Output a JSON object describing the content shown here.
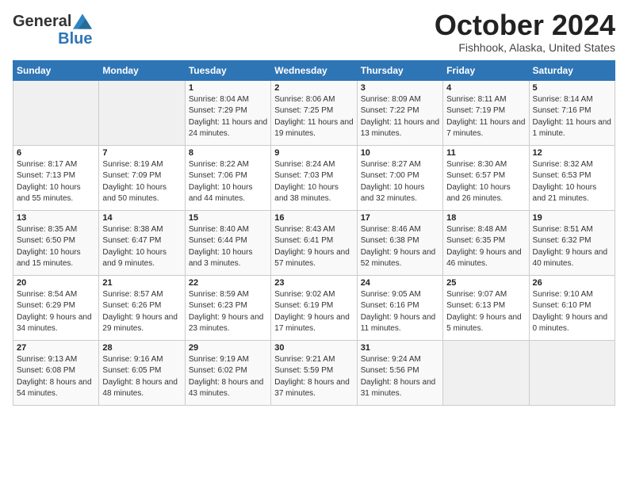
{
  "logo": {
    "general": "General",
    "blue": "Blue"
  },
  "title": {
    "month_year": "October 2024",
    "location": "Fishhook, Alaska, United States"
  },
  "weekdays": [
    "Sunday",
    "Monday",
    "Tuesday",
    "Wednesday",
    "Thursday",
    "Friday",
    "Saturday"
  ],
  "weeks": [
    [
      {
        "day": "",
        "empty": true
      },
      {
        "day": "",
        "empty": true
      },
      {
        "day": "1",
        "sunrise": "Sunrise: 8:04 AM",
        "sunset": "Sunset: 7:29 PM",
        "daylight": "Daylight: 11 hours and 24 minutes."
      },
      {
        "day": "2",
        "sunrise": "Sunrise: 8:06 AM",
        "sunset": "Sunset: 7:25 PM",
        "daylight": "Daylight: 11 hours and 19 minutes."
      },
      {
        "day": "3",
        "sunrise": "Sunrise: 8:09 AM",
        "sunset": "Sunset: 7:22 PM",
        "daylight": "Daylight: 11 hours and 13 minutes."
      },
      {
        "day": "4",
        "sunrise": "Sunrise: 8:11 AM",
        "sunset": "Sunset: 7:19 PM",
        "daylight": "Daylight: 11 hours and 7 minutes."
      },
      {
        "day": "5",
        "sunrise": "Sunrise: 8:14 AM",
        "sunset": "Sunset: 7:16 PM",
        "daylight": "Daylight: 11 hours and 1 minute."
      }
    ],
    [
      {
        "day": "6",
        "sunrise": "Sunrise: 8:17 AM",
        "sunset": "Sunset: 7:13 PM",
        "daylight": "Daylight: 10 hours and 55 minutes."
      },
      {
        "day": "7",
        "sunrise": "Sunrise: 8:19 AM",
        "sunset": "Sunset: 7:09 PM",
        "daylight": "Daylight: 10 hours and 50 minutes."
      },
      {
        "day": "8",
        "sunrise": "Sunrise: 8:22 AM",
        "sunset": "Sunset: 7:06 PM",
        "daylight": "Daylight: 10 hours and 44 minutes."
      },
      {
        "day": "9",
        "sunrise": "Sunrise: 8:24 AM",
        "sunset": "Sunset: 7:03 PM",
        "daylight": "Daylight: 10 hours and 38 minutes."
      },
      {
        "day": "10",
        "sunrise": "Sunrise: 8:27 AM",
        "sunset": "Sunset: 7:00 PM",
        "daylight": "Daylight: 10 hours and 32 minutes."
      },
      {
        "day": "11",
        "sunrise": "Sunrise: 8:30 AM",
        "sunset": "Sunset: 6:57 PM",
        "daylight": "Daylight: 10 hours and 26 minutes."
      },
      {
        "day": "12",
        "sunrise": "Sunrise: 8:32 AM",
        "sunset": "Sunset: 6:53 PM",
        "daylight": "Daylight: 10 hours and 21 minutes."
      }
    ],
    [
      {
        "day": "13",
        "sunrise": "Sunrise: 8:35 AM",
        "sunset": "Sunset: 6:50 PM",
        "daylight": "Daylight: 10 hours and 15 minutes."
      },
      {
        "day": "14",
        "sunrise": "Sunrise: 8:38 AM",
        "sunset": "Sunset: 6:47 PM",
        "daylight": "Daylight: 10 hours and 9 minutes."
      },
      {
        "day": "15",
        "sunrise": "Sunrise: 8:40 AM",
        "sunset": "Sunset: 6:44 PM",
        "daylight": "Daylight: 10 hours and 3 minutes."
      },
      {
        "day": "16",
        "sunrise": "Sunrise: 8:43 AM",
        "sunset": "Sunset: 6:41 PM",
        "daylight": "Daylight: 9 hours and 57 minutes."
      },
      {
        "day": "17",
        "sunrise": "Sunrise: 8:46 AM",
        "sunset": "Sunset: 6:38 PM",
        "daylight": "Daylight: 9 hours and 52 minutes."
      },
      {
        "day": "18",
        "sunrise": "Sunrise: 8:48 AM",
        "sunset": "Sunset: 6:35 PM",
        "daylight": "Daylight: 9 hours and 46 minutes."
      },
      {
        "day": "19",
        "sunrise": "Sunrise: 8:51 AM",
        "sunset": "Sunset: 6:32 PM",
        "daylight": "Daylight: 9 hours and 40 minutes."
      }
    ],
    [
      {
        "day": "20",
        "sunrise": "Sunrise: 8:54 AM",
        "sunset": "Sunset: 6:29 PM",
        "daylight": "Daylight: 9 hours and 34 minutes."
      },
      {
        "day": "21",
        "sunrise": "Sunrise: 8:57 AM",
        "sunset": "Sunset: 6:26 PM",
        "daylight": "Daylight: 9 hours and 29 minutes."
      },
      {
        "day": "22",
        "sunrise": "Sunrise: 8:59 AM",
        "sunset": "Sunset: 6:23 PM",
        "daylight": "Daylight: 9 hours and 23 minutes."
      },
      {
        "day": "23",
        "sunrise": "Sunrise: 9:02 AM",
        "sunset": "Sunset: 6:19 PM",
        "daylight": "Daylight: 9 hours and 17 minutes."
      },
      {
        "day": "24",
        "sunrise": "Sunrise: 9:05 AM",
        "sunset": "Sunset: 6:16 PM",
        "daylight": "Daylight: 9 hours and 11 minutes."
      },
      {
        "day": "25",
        "sunrise": "Sunrise: 9:07 AM",
        "sunset": "Sunset: 6:13 PM",
        "daylight": "Daylight: 9 hours and 5 minutes."
      },
      {
        "day": "26",
        "sunrise": "Sunrise: 9:10 AM",
        "sunset": "Sunset: 6:10 PM",
        "daylight": "Daylight: 9 hours and 0 minutes."
      }
    ],
    [
      {
        "day": "27",
        "sunrise": "Sunrise: 9:13 AM",
        "sunset": "Sunset: 6:08 PM",
        "daylight": "Daylight: 8 hours and 54 minutes."
      },
      {
        "day": "28",
        "sunrise": "Sunrise: 9:16 AM",
        "sunset": "Sunset: 6:05 PM",
        "daylight": "Daylight: 8 hours and 48 minutes."
      },
      {
        "day": "29",
        "sunrise": "Sunrise: 9:19 AM",
        "sunset": "Sunset: 6:02 PM",
        "daylight": "Daylight: 8 hours and 43 minutes."
      },
      {
        "day": "30",
        "sunrise": "Sunrise: 9:21 AM",
        "sunset": "Sunset: 5:59 PM",
        "daylight": "Daylight: 8 hours and 37 minutes."
      },
      {
        "day": "31",
        "sunrise": "Sunrise: 9:24 AM",
        "sunset": "Sunset: 5:56 PM",
        "daylight": "Daylight: 8 hours and 31 minutes."
      },
      {
        "day": "",
        "empty": true
      },
      {
        "day": "",
        "empty": true
      }
    ]
  ]
}
